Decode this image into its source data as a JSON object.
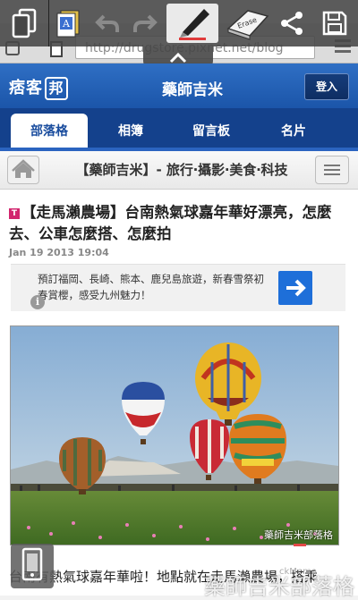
{
  "browser": {
    "url": "http://drugstore.pixnet.net/blog"
  },
  "memo_toolbar": {
    "icons": [
      "copy-screen-icon",
      "text-mode-icon",
      "undo-icon",
      "redo-icon",
      "pen-icon",
      "eraser-icon",
      "share-icon",
      "save-icon"
    ],
    "eraser_label": "Erase",
    "pen_color": "#e03b3b"
  },
  "header": {
    "logo_text": "痞客",
    "logo_box": "邦",
    "site_title": "藥師吉米",
    "login_label": "登入"
  },
  "tabs": [
    {
      "label": "部落格",
      "active": true
    },
    {
      "label": "相簿",
      "active": false
    },
    {
      "label": "留言板",
      "active": false
    },
    {
      "label": "名片",
      "active": false
    }
  ],
  "subheader": {
    "title": "【藥師吉米】- 旅行‧攝影‧美食‧科技"
  },
  "post": {
    "pin_label": "T",
    "title": "【走馬瀨農場】台南熱氣球嘉年華好漂亮，怎麼去、公車怎麼搭、怎麼拍",
    "date": "Jan 19 2013 19:04",
    "ad_text": "預訂福岡、長崎、熊本、鹿兒島旅遊，新春雪祭初春賞櫻，感受九州魅力！",
    "ad_info": "i",
    "photo_watermark": "藥師吉米部落格",
    "caption": "台南有熱氣球嘉年華啦！地點就在走馬瀨農場，搭乘",
    "bottom_watermark": "藥師吉米部落格",
    "side_watermark": "ckMemo"
  },
  "colors": {
    "header_blue": "#2364b8",
    "tab_bar": "#14418c",
    "ad_arrow": "#1e6fd9"
  }
}
